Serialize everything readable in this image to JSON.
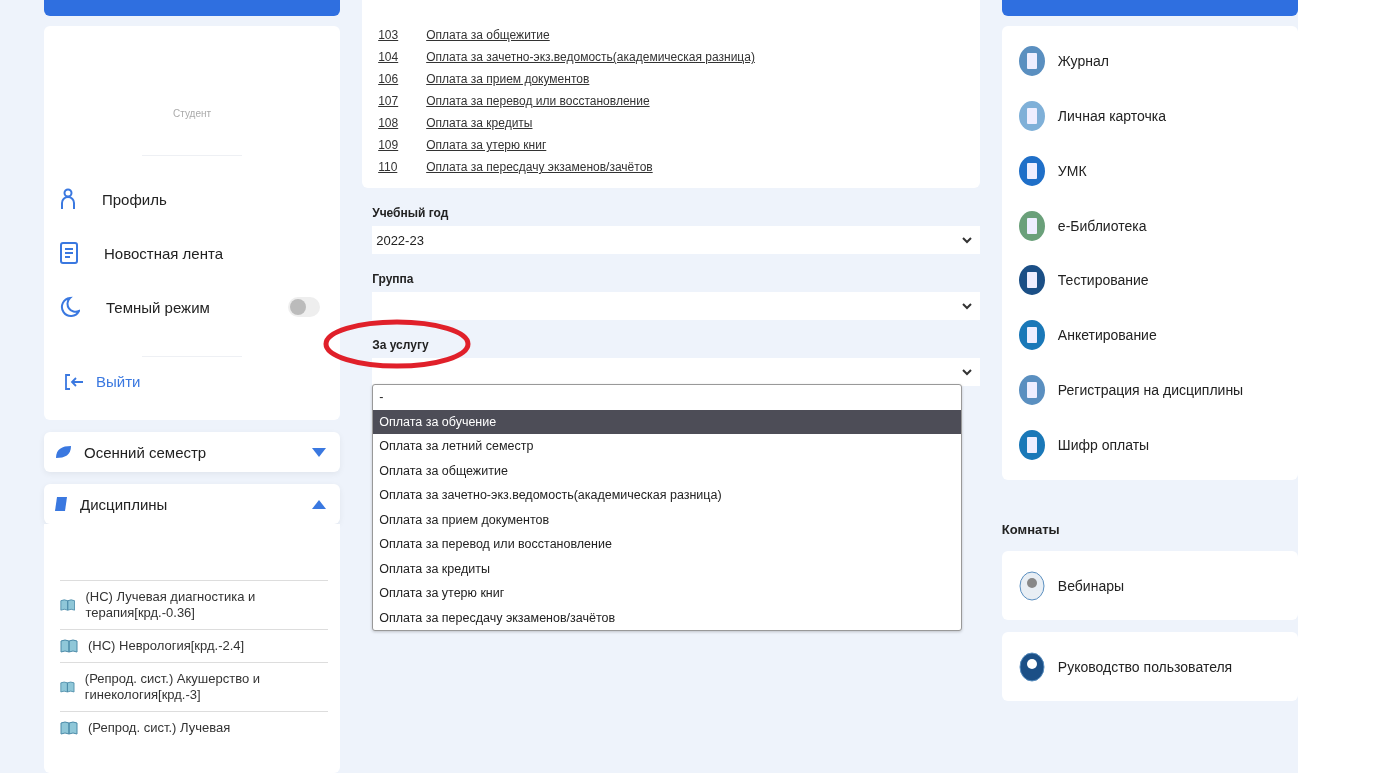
{
  "sidebar": {
    "role": "Студент",
    "menu": [
      {
        "kind": "link",
        "label": "Профиль"
      },
      {
        "kind": "link",
        "label": "Новостная лента"
      },
      {
        "kind": "toggle",
        "label": "Темный режим",
        "on": false
      }
    ],
    "logout": "Выйти",
    "sections": [
      {
        "title": "Осенний семестр",
        "expanded": false
      },
      {
        "title": "Дисциплины",
        "expanded": true
      }
    ],
    "disciplines": [
      "(НС) Лучевая диагностика и терапия[крд.-0.36]",
      "(НС) Неврология[крд.-2.4]",
      "(Репрод. сист.) Акушерство и гинекология[крд.-3]",
      "(Репрод. сист.) Лучевая"
    ]
  },
  "codes": [
    {
      "code": "103",
      "label": "Оплата за общежитие"
    },
    {
      "code": "104",
      "label": "Оплата за зачетно-экз.ведомость(академическая разница)"
    },
    {
      "code": "106",
      "label": "Оплата за прием документов"
    },
    {
      "code": "107",
      "label": "Оплата за перевод или восстановление"
    },
    {
      "code": "108",
      "label": "Оплата за кредиты"
    },
    {
      "code": "109",
      "label": "Оплата за утерю книг"
    },
    {
      "code": "110",
      "label": "Оплата за пересдачу экзаменов/зачётов"
    }
  ],
  "form": [
    {
      "label": "Учебный год",
      "value": "2022-23"
    },
    {
      "label": "Группа"
    },
    {
      "label": "За услугу",
      "options": [
        {
          "label": "-",
          "selected": false
        },
        {
          "label": "Оплата за обучение",
          "selected": true
        },
        {
          "label": "Оплата за летний семестр",
          "selected": false
        },
        {
          "label": "Оплата за общежитие",
          "selected": false
        },
        {
          "label": "Оплата за зачетно-экз.ведомость(академическая разница)",
          "selected": false
        },
        {
          "label": "Оплата за прием документов",
          "selected": false
        },
        {
          "label": "Оплата за перевод или восстановление",
          "selected": false
        },
        {
          "label": "Оплата за кредиты",
          "selected": false
        },
        {
          "label": "Оплата за утерю книг",
          "selected": false
        },
        {
          "label": "Оплата за пересдачу экзаменов/зачётов",
          "selected": false
        }
      ]
    }
  ],
  "services": [
    "Журнал",
    "Личная карточка",
    "УМК",
    "е-Библиотека",
    "Тестирование",
    "Анкетирование",
    "Регистрация на дисциплины",
    "Шифр оплаты"
  ],
  "rooms": {
    "title": "Комнаты",
    "items": [
      "Вебинары",
      "Руководство пользователя"
    ]
  }
}
